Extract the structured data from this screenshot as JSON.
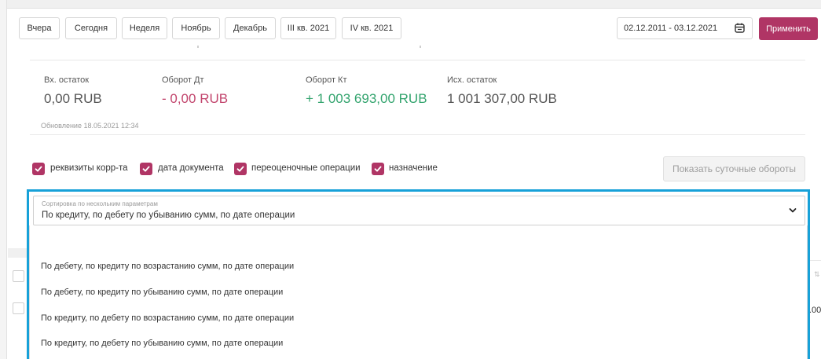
{
  "period_buttons": [
    "Вчера",
    "Сегодня",
    "Неделя",
    "Ноябрь",
    "Декабрь",
    "III кв. 2021",
    "IV кв. 2021"
  ],
  "date_range": "02.12.2011 - 03.12.2021",
  "apply_label": "Применить",
  "stats": [
    {
      "label": "Вх. остаток",
      "value": "0,00 RUB",
      "color": "#555555"
    },
    {
      "label": "Оборот Дт",
      "value": "- 0,00 RUB",
      "color": "#c2456d"
    },
    {
      "label": "Оборот Кт",
      "value": "+ 1 003 693,00 RUB",
      "color": "#33a46e"
    },
    {
      "label": "Исх. остаток",
      "value": "1 001 307,00 RUB",
      "color": "#555555"
    }
  ],
  "update_text": "Обновление 18.05.2021 12:34",
  "checkboxes": [
    {
      "label": "реквизиты корр-та",
      "checked": true
    },
    {
      "label": "дата документа",
      "checked": true
    },
    {
      "label": "переоценочные операции",
      "checked": true
    },
    {
      "label": "назначение",
      "checked": true
    }
  ],
  "daily_button": "Показать суточные обороты",
  "sort": {
    "caption": "Сортировка по нескольким параметрам",
    "selected": "По кредиту, по дебету по убыванию сумм, по дате операции",
    "options": [
      "По дебету, по кредиту по возрастанию сумм, по дате операции",
      "По дебету, по кредиту по убыванию сумм, по дате операции",
      "По кредиту, по дебету по возрастанию сумм, по дате операции",
      "По кредиту, по дебету по убыванию сумм, по дате операции"
    ]
  },
  "background_partial": ".00",
  "colors": {
    "accent": "#b03565",
    "focus": "#17a1d8",
    "credit": "#33a46e",
    "debit": "#c2456d"
  }
}
